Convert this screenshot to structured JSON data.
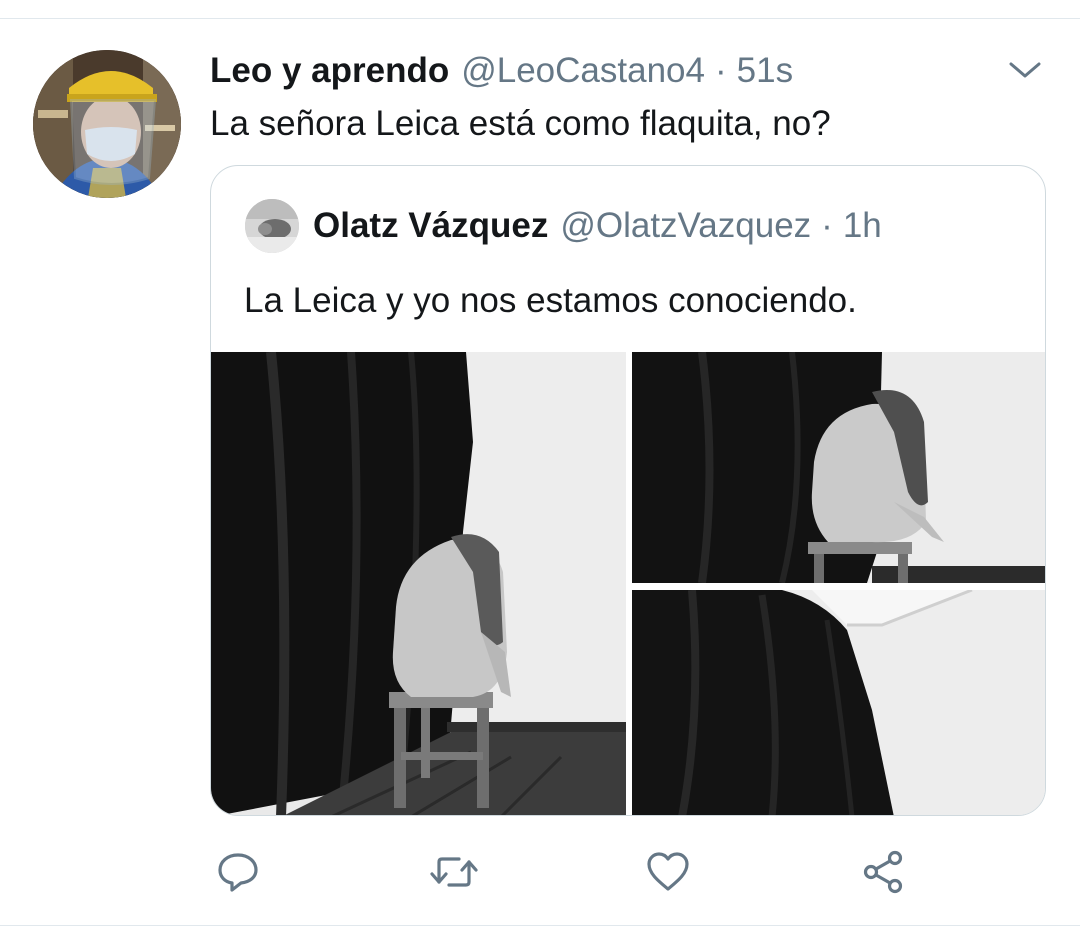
{
  "tweet": {
    "display_name": "Leo y aprendo",
    "handle": "@LeoCastano4",
    "separator": "·",
    "time": "51s",
    "text": "La señora Leica está como flaquita, no?",
    "avatar_icon": "user-avatar-face-shield"
  },
  "quoted_tweet": {
    "display_name": "Olatz Vázquez",
    "handle": "@OlatzVazquez",
    "separator": "·",
    "time": "1h",
    "text": "La Leica y yo nos estamos conociendo.",
    "photos": [
      "photo-seated-on-stool",
      "photo-seated-closeup",
      "photo-curtain-corner"
    ]
  },
  "actions": [
    {
      "name": "reply",
      "icon": "reply-icon"
    },
    {
      "name": "retweet",
      "icon": "retweet-icon"
    },
    {
      "name": "like",
      "icon": "heart-icon"
    },
    {
      "name": "share",
      "icon": "share-icon"
    }
  ],
  "colors": {
    "text_primary": "#14171a",
    "text_secondary": "#657786",
    "icon_gray": "#657786",
    "divider": "#e1e8ed",
    "card_border": "#cfd9de"
  }
}
